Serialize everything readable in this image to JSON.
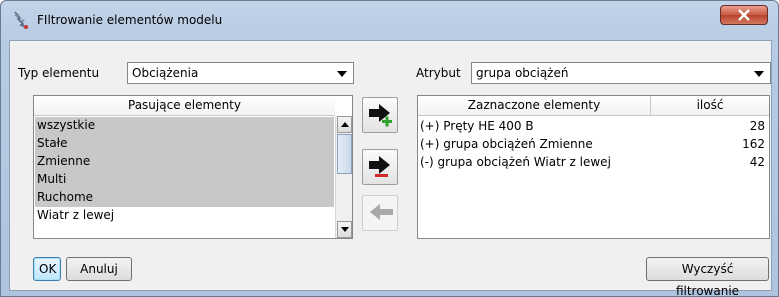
{
  "window": {
    "title": "FIltrowanie elementów modelu"
  },
  "left": {
    "type_label": "Typ elementu",
    "type_value": "Obciążenia",
    "list_header": "Pasujące elementy",
    "items": [
      "wszystkie",
      "Stałe",
      "Zmienne",
      "Multi",
      "Ruchome",
      "Wiatr z lewej"
    ],
    "selected": [
      true,
      true,
      true,
      true,
      true,
      false
    ]
  },
  "right": {
    "attr_label": "Atrybut",
    "attr_value": "grupa obciążeń",
    "col_selected": "Zaznaczone elementy",
    "col_count": "ilość",
    "rows": [
      {
        "name": "(+) Pręty HE 400 B",
        "count": "28"
      },
      {
        "name": "(+) grupa obciążeń Zmienne",
        "count": "162"
      },
      {
        "name": "(-) grupa obciążeń Wiatr z lewej",
        "count": "42"
      }
    ]
  },
  "buttons": {
    "ok": "OK",
    "cancel": "Anuluj",
    "clear": "Wyczyść filtrowanie"
  },
  "colors": {
    "add": "#2fa12f",
    "remove": "#d02828",
    "selection": "#c8c8c8"
  }
}
